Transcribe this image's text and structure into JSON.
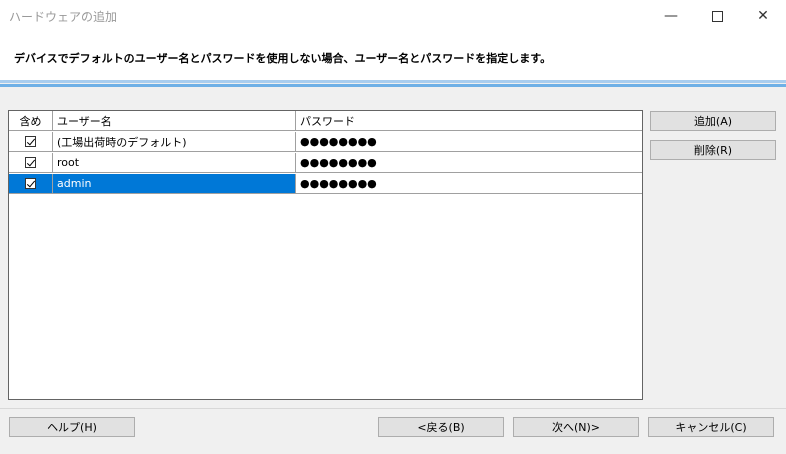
{
  "window": {
    "title": "ハードウェアの追加",
    "minimize_icon": "minimize-icon",
    "maximize_icon": "maximize-icon",
    "close_icon": "close-icon"
  },
  "header": {
    "instruction": "デバイスでデフォルトのユーザー名とパスワードを使用しない場合、ユーザー名とパスワードを指定します。"
  },
  "table": {
    "columns": [
      "含め",
      "ユーザー名",
      "パスワード"
    ],
    "rows": [
      {
        "include": true,
        "username": "(工場出荷時のデフォルト)",
        "password": "●●●●●●●●",
        "selected": false
      },
      {
        "include": true,
        "username": "root",
        "password": "●●●●●●●●",
        "selected": false
      },
      {
        "include": true,
        "username": "admin",
        "password": "●●●●●●●●",
        "selected": true
      }
    ]
  },
  "side_buttons": {
    "add": "追加(A)",
    "delete": "削除(R)"
  },
  "footer": {
    "help": "ヘルプ(H)",
    "back": "<戻る(B)",
    "next": "次へ(N)>",
    "cancel": "キャンセル(C)"
  },
  "colors": {
    "selection": "#0078d7",
    "header_line_light": "#a9cdee",
    "header_line_dark": "#6fb0e6"
  }
}
